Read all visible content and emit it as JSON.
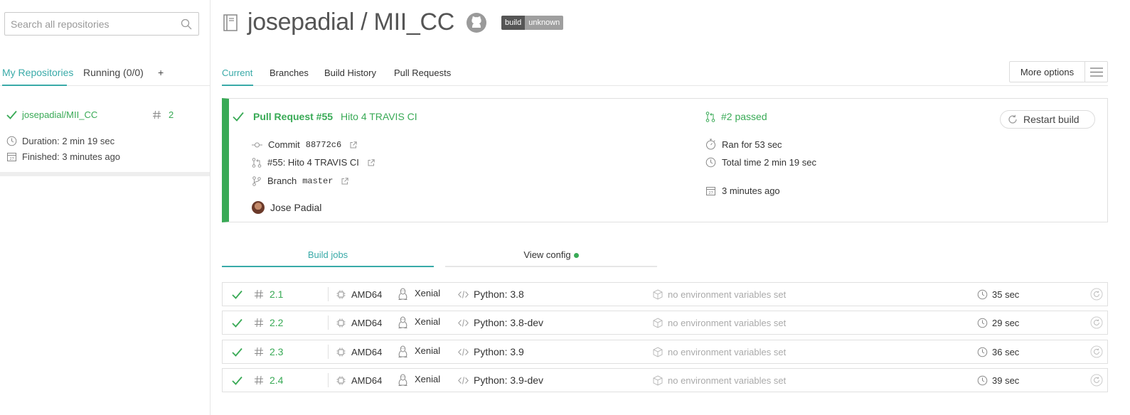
{
  "sidebar": {
    "search_placeholder": "Search all repositories",
    "tabs": [
      {
        "label": "My Repositories"
      },
      {
        "label": "Running (0/0)"
      },
      {
        "label": "+"
      }
    ],
    "repo": {
      "name": "josepadial/MII_CC",
      "build_number": "2",
      "duration": "Duration: 2 min 19 sec",
      "finished": "Finished: 3 minutes ago"
    }
  },
  "header": {
    "title": "josepadial / MII_CC",
    "badge_left": "build",
    "badge_right": "unknown"
  },
  "main_tabs": [
    {
      "label": "Current"
    },
    {
      "label": "Branches"
    },
    {
      "label": "Build History"
    },
    {
      "label": "Pull Requests"
    }
  ],
  "more_options_label": "More options",
  "build": {
    "pr_label": "Pull Request #55",
    "pr_title": "Hito 4 TRAVIS CI",
    "commit_label": "Commit",
    "commit_hash": "88772c6",
    "pr_link": "#55: Hito 4 TRAVIS CI",
    "branch_label": "Branch",
    "branch_name": "master",
    "author": "Jose Padial",
    "status": "#2 passed",
    "ran_for": "Ran for 53 sec",
    "total_time": "Total time 2 min 19 sec",
    "finished": "3 minutes ago",
    "restart_label": "Restart build"
  },
  "job_tabs": [
    {
      "label": "Build jobs"
    },
    {
      "label": "View config"
    }
  ],
  "jobs": [
    {
      "number": "2.1",
      "arch": "AMD64",
      "os": "Xenial",
      "language": "Python: 3.8",
      "env": "no environment variables set",
      "duration": "35 sec"
    },
    {
      "number": "2.2",
      "arch": "AMD64",
      "os": "Xenial",
      "language": "Python: 3.8-dev",
      "env": "no environment variables set",
      "duration": "29 sec"
    },
    {
      "number": "2.3",
      "arch": "AMD64",
      "os": "Xenial",
      "language": "Python: 3.9",
      "env": "no environment variables set",
      "duration": "36 sec"
    },
    {
      "number": "2.4",
      "arch": "AMD64",
      "os": "Xenial",
      "language": "Python: 3.9-dev",
      "env": "no environment variables set",
      "duration": "39 sec"
    }
  ],
  "colors": {
    "passed": "#39aa56",
    "accent": "#39aaa8",
    "muted": "#aaaaaa"
  }
}
